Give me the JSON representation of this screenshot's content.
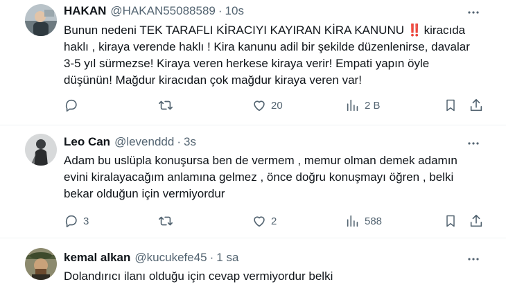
{
  "tweets": [
    {
      "name": "HAKAN",
      "handle": "@HAKAN55088589",
      "time": "10s",
      "text_before_emoji": "Bunun nedeni TEK TARAFLI KİRACIYI KAYIRAN KİRA KANUNU ",
      "emoji": "‼️",
      "text_after_emoji": " kiracıda haklı , kiraya verende haklı ! Kira kanunu adil bir şekilde düzenlenirse, davalar 3-5 yıl sürmezse! Kiraya veren herkese kiraya verir! Empati yapın öyle düşünün! Mağdur kiracıdan çok mağdur kiraya veren var!",
      "replies": "",
      "retweets": "",
      "likes": "20",
      "views": "2 B"
    },
    {
      "name": "Leo Can",
      "handle": "@levenddd",
      "time": "3s",
      "text": "Adam bu uslüpla konuşursa ben de vermem , memur olman demek adamın evini kiralayacağım anlamına gelmez , önce doğru konuşmayı öğren , belki bekar olduğun için vermiyordur",
      "replies": "3",
      "retweets": "",
      "likes": "2",
      "views": "588"
    },
    {
      "name": "kemal alkan",
      "handle": "@kucukefe45",
      "time": "1 sa",
      "text": "Dolandırıcı ilanı olduğu için cevap vermiyordur belki"
    }
  ],
  "icons": {
    "reply": "reply-icon",
    "retweet": "retweet-icon",
    "like": "heart-icon",
    "views": "views-bar-chart-icon",
    "bookmark": "bookmark-icon",
    "share": "share-icon",
    "more": "more-dots-icon"
  },
  "colors": {
    "text": "#0f1419",
    "secondary": "#536471",
    "divider": "#eff3f4",
    "emoji_red": "#e0245e"
  }
}
